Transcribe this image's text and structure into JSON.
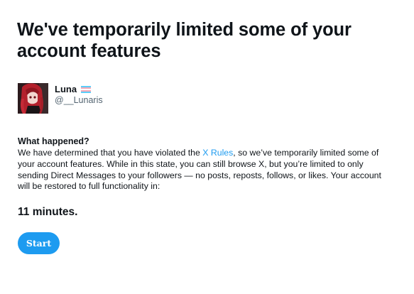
{
  "title": "We've temporarily limited some of your account features",
  "user": {
    "display_name": "Luna",
    "handle": "@__Lunaris",
    "flag_icon": "trans-flag-icon",
    "flag_colors": [
      "#5bcefa",
      "#f5a9b8",
      "#ffffff"
    ]
  },
  "notice": {
    "heading": "What happened?",
    "text_before_link": "We have determined that you have violated the ",
    "link_text": "X Rules",
    "text_after_link": ", so we’ve temporarily limited some of your account features. While in this state, you can still browse X, but you’re limited to only sending Direct Messages to your followers — no posts, reposts, follows, or likes. Your account will be restored to full functionality in:",
    "countdown": "11 minutes."
  },
  "actions": {
    "start_label": "Start"
  },
  "colors": {
    "accent": "#1d9bf0",
    "text": "#0f1419",
    "secondary_text": "#536471"
  }
}
